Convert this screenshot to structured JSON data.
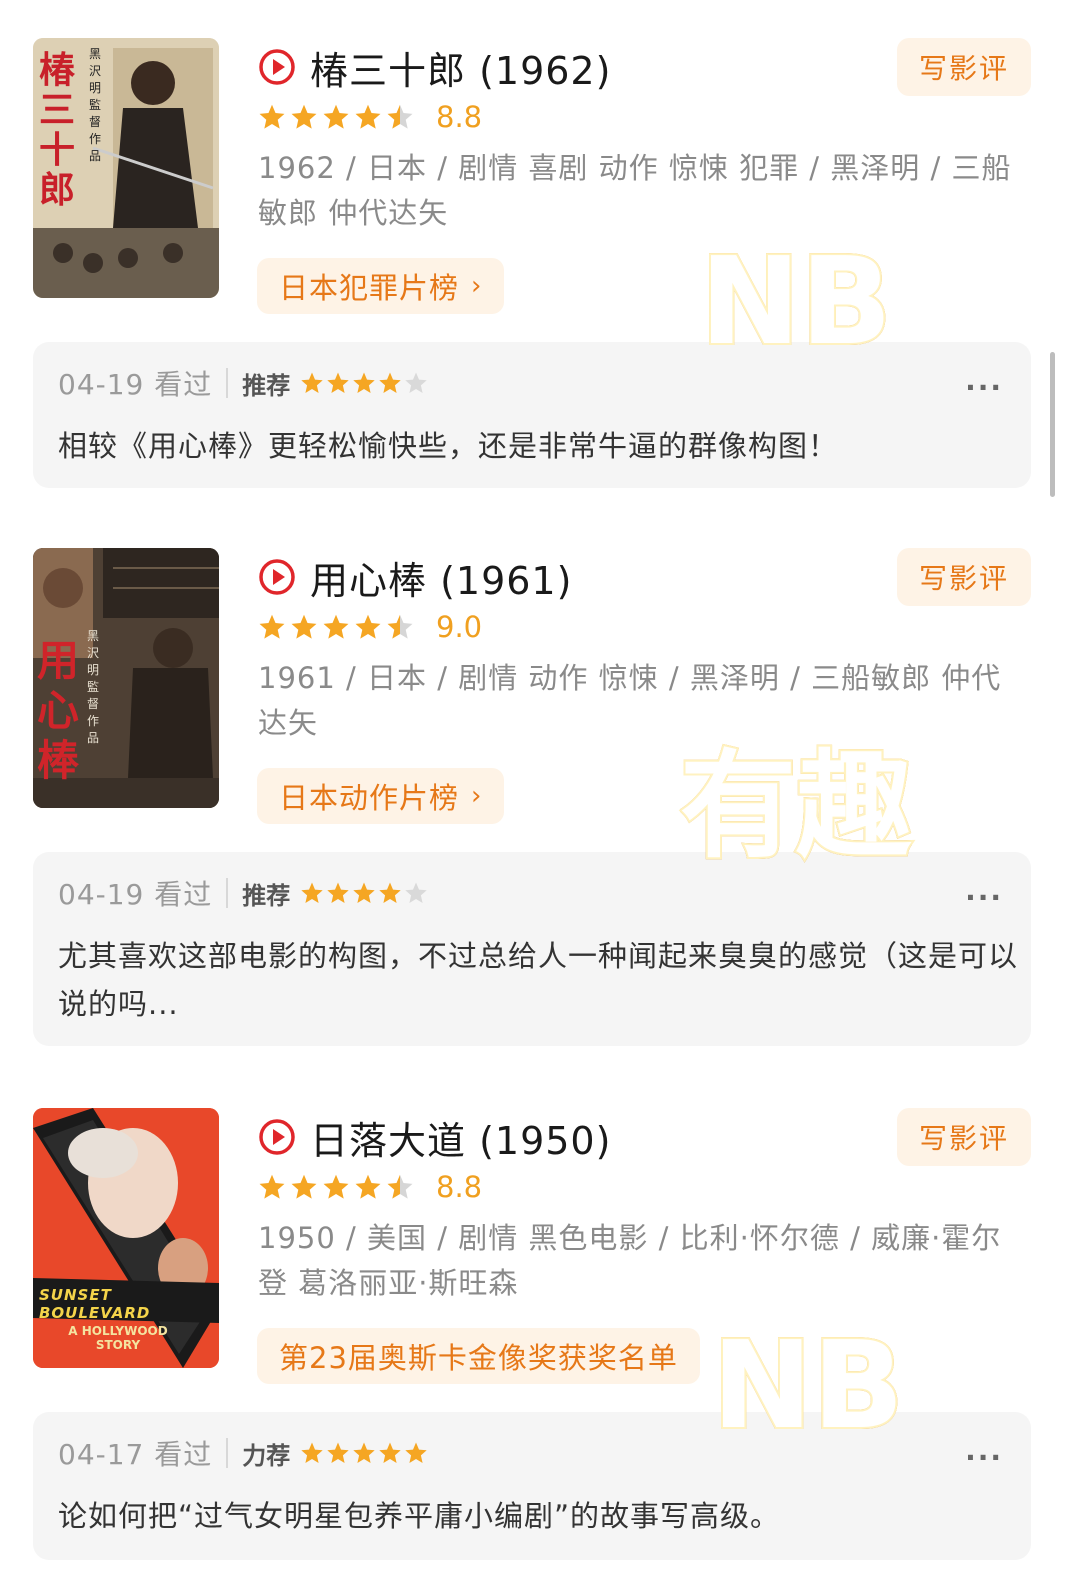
{
  "movies": [
    {
      "title": "椿三十郎 (1962)",
      "score": "8.8",
      "stars_filled": 4.5,
      "meta": "1962 / 日本 / 剧情 喜剧 动作 惊悚 犯罪 / 黑泽明 / 三船敏郎 仲代达矢",
      "tag": "日本犯罪片榜",
      "write_review": "写影评",
      "poster_title": "椿三十郎",
      "poster_credit": "黑沢明監督作品",
      "review": {
        "date": "04-19 看过",
        "recommend": "推荐",
        "stars": 4,
        "text": "相较《用心棒》更轻松愉快些，还是非常牛逼的群像构图！"
      }
    },
    {
      "title": "用心棒 (1961)",
      "score": "9.0",
      "stars_filled": 4.5,
      "meta": "1961 / 日本 / 剧情 动作 惊悚 / 黑泽明 / 三船敏郎 仲代达矢",
      "tag": "日本动作片榜",
      "write_review": "写影评",
      "poster_title": "用心棒",
      "poster_credit": "黑沢明監督作品",
      "review": {
        "date": "04-19 看过",
        "recommend": "推荐",
        "stars": 4,
        "text": "尤其喜欢这部电影的构图，不过总给人一种闻起来臭臭的感觉（这是可以说的吗..."
      }
    },
    {
      "title": "日落大道 (1950)",
      "score": "8.8",
      "stars_filled": 4.5,
      "meta": "1950 / 美国 / 剧情 黑色电影 / 比利·怀尔德 / 威廉·霍尔登 葛洛丽亚·斯旺森",
      "tag": "第23届奥斯卡金像奖获奖名单",
      "write_review": "写影评",
      "poster_title": "SUNSET BOULEVARD",
      "poster_subtitle": "A HOLLYWOOD STORY",
      "review": {
        "date": "04-17 看过",
        "recommend": "力荐",
        "stars": 5,
        "text": "论如何把“过气女明星包养平庸小编剧”的故事写高级。"
      }
    }
  ],
  "stickers": [
    "NB",
    "有趣",
    "NB"
  ],
  "more_icon": "...",
  "colors": {
    "accent": "#e67818",
    "star": "#f5a623",
    "play": "#e0262b",
    "card_bg": "#f5f5f5"
  }
}
